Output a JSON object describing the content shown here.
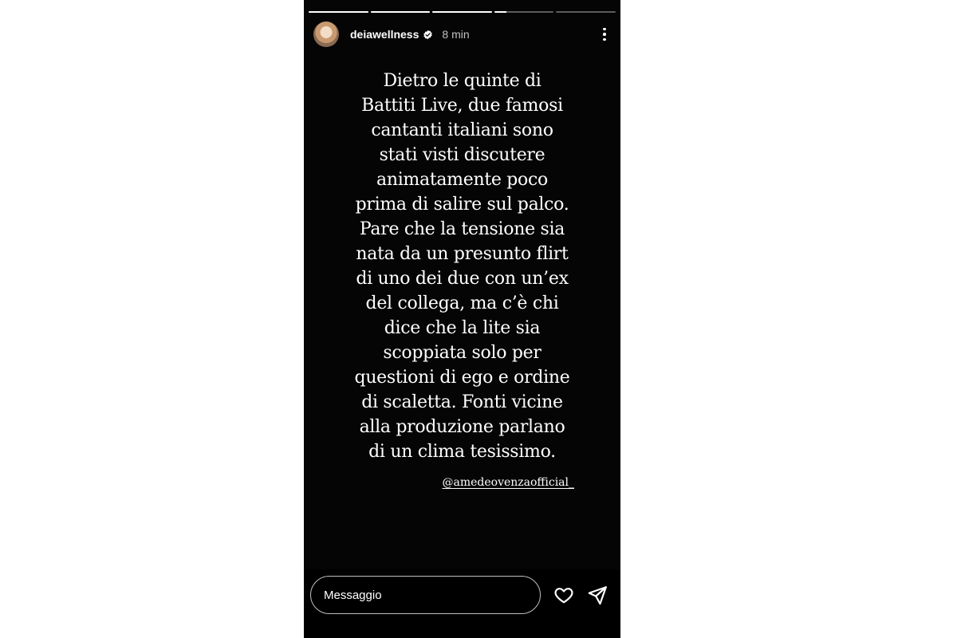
{
  "story": {
    "progress": [
      1,
      1,
      1,
      0.2,
      0
    ],
    "username": "deiawellness",
    "verified_icon": "verified-badge-icon",
    "time": "8 min",
    "text_lines": [
      "Dietro le quinte di",
      "Battiti Live, due famosi",
      "cantanti italiani sono",
      "stati visti discutere",
      "animatamente poco",
      "prima di salire sul palco.",
      "Pare che la tensione sia",
      "nata da un presunto flirt",
      "di uno dei due con un’ex",
      "del collega, ma c’è chi",
      "dice che la lite sia",
      "scoppiata solo per",
      "questioni di ego e ordine",
      "di scaletta. Fonti vicine",
      "alla produzione parlano",
      "di un clima tesissimo."
    ],
    "mention": "@amedeovenzaofficial_"
  },
  "footer": {
    "message_placeholder": "Messaggio",
    "like_icon": "heart-icon",
    "share_icon": "send-icon"
  },
  "colors": {
    "background": "#ffffff",
    "story_bg": "#050505",
    "text": "#ffffff"
  }
}
